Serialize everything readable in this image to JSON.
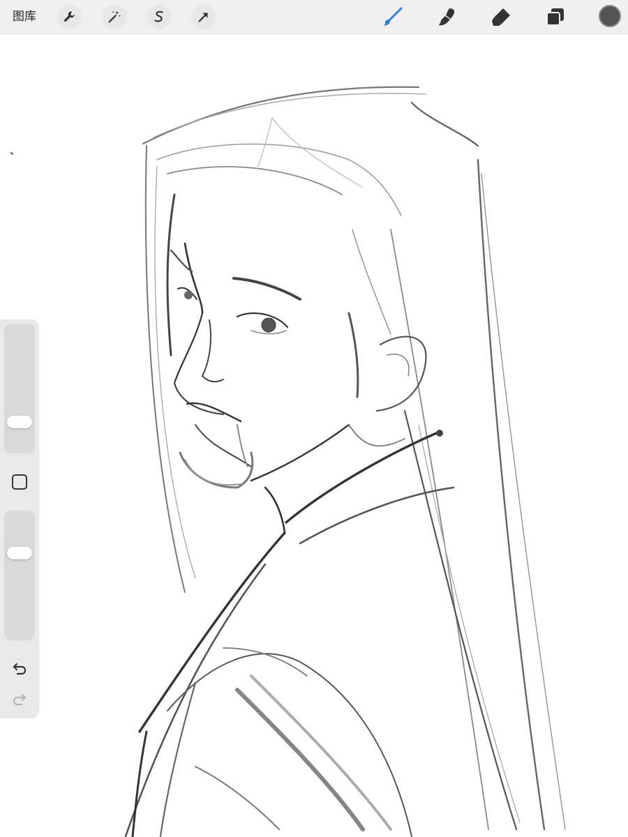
{
  "toolbar": {
    "gallery_label": "图库",
    "tools": [
      {
        "name": "actions",
        "icon": "wrench-icon"
      },
      {
        "name": "adjustments",
        "icon": "magic-wand-icon"
      },
      {
        "name": "selection",
        "icon": "selection-s-icon"
      },
      {
        "name": "transform",
        "icon": "arrow-cursor-icon"
      }
    ],
    "right_tools": [
      {
        "name": "brush",
        "icon": "brush-icon",
        "active": true
      },
      {
        "name": "smudge",
        "icon": "smudge-icon",
        "active": false
      },
      {
        "name": "eraser",
        "icon": "eraser-icon",
        "active": false
      },
      {
        "name": "layers",
        "icon": "layers-icon",
        "active": false
      }
    ],
    "current_color": "#555555",
    "accent_color": "#2f7de1"
  },
  "sidebar": {
    "brush_size_level": 0.2,
    "opacity_level": 0.7,
    "modify_icon": "square-icon",
    "undo_icon": "undo-icon",
    "redo_icon": "redo-icon"
  }
}
